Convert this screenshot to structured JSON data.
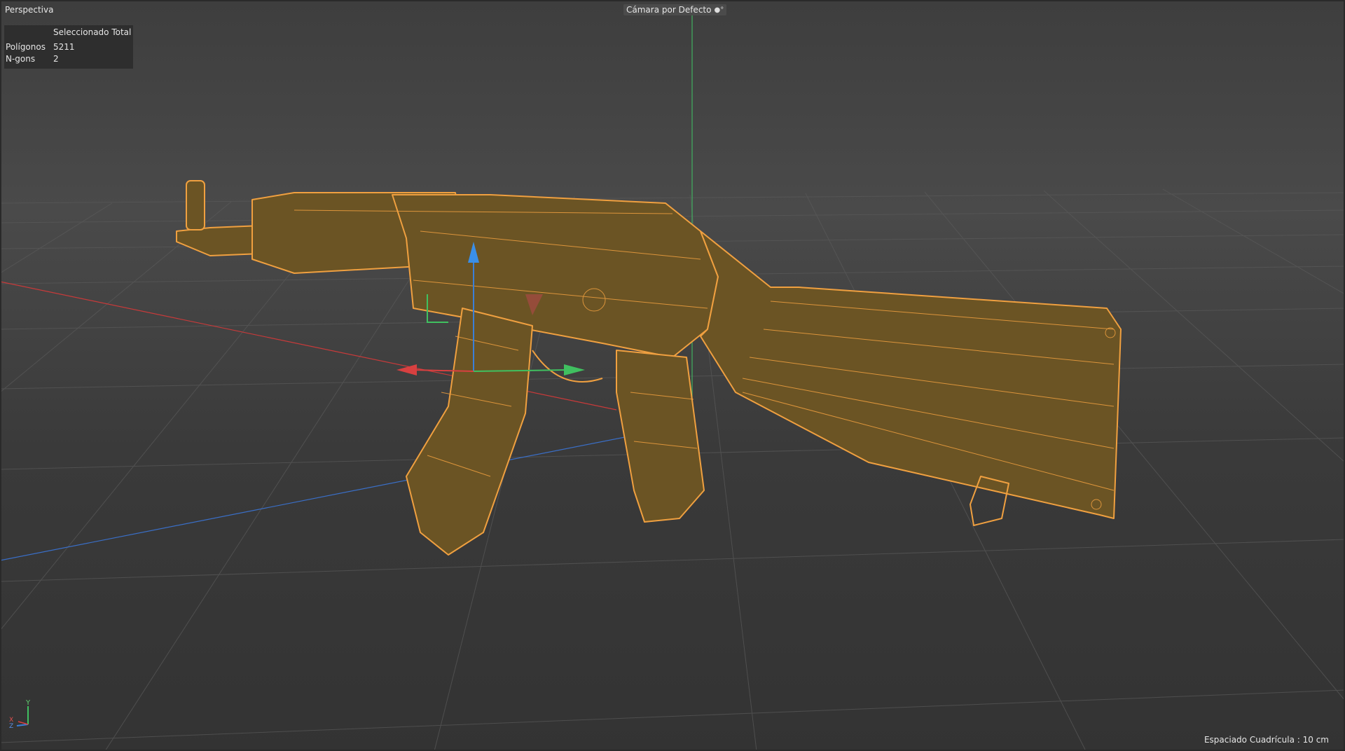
{
  "viewport": {
    "name": "Perspectiva",
    "camera": "Cámara por Defecto",
    "camera_icon": "camera-options-icon"
  },
  "stats": {
    "header": "Seleccionado Total",
    "rows": [
      {
        "label": "Polígonos",
        "value": "5211"
      },
      {
        "label": "N-gons",
        "value": "2"
      }
    ]
  },
  "footer": {
    "grid_spacing": "Espaciado Cuadrícula : 10 cm"
  },
  "axis": {
    "y": "Y",
    "x": "X",
    "z": "Z"
  },
  "colors": {
    "model_fill": "#6b5424",
    "wire": "#f0a040",
    "x_axis": "#d84040",
    "y_axis": "#40c060",
    "z_axis": "#3a7fd8"
  }
}
